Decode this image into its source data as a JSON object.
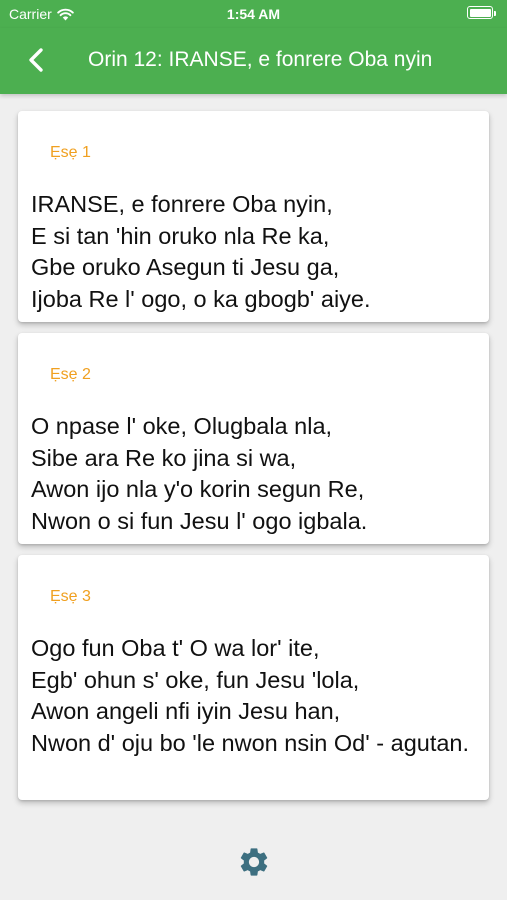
{
  "status_bar": {
    "carrier": "Carrier",
    "time": "1:54 AM",
    "icons": [
      "wifi-icon",
      "battery-icon"
    ]
  },
  "nav": {
    "back_icon": "chevron-left-icon",
    "title": "Orin 12: IRANSE, e fonrere Oba nyin"
  },
  "verses": [
    {
      "label": "Ẹsẹ 1",
      "text": "IRANSE, e fonrere Oba nyin,\nE si tan 'hin oruko nla Re ka,\nGbe oruko Asegun ti Jesu ga,\nIjoba Re l' ogo, o ka gbogb' aiye."
    },
    {
      "label": "Ẹsẹ 2",
      "text": "O npase l' oke, Olugbala nla,\nSibe ara Re ko jina si wa,\nAwon ijo nla y'o korin segun Re,\nNwon o si fun Jesu l' ogo igbala."
    },
    {
      "label": "Ẹsẹ 3",
      "text": "Ogo fun Oba t' O wa lor' ite,\nEgb' ohun s' oke, fun Jesu 'lola,\nAwon  angeli nfi iyin Jesu han,\nNwon d' oju bo 'le nwon nsin Od' - agutan."
    }
  ],
  "bottom_bar": {
    "settings_icon": "gear-icon"
  },
  "colors": {
    "primary": "#4caf50",
    "verse_label": "#f0a020",
    "background": "#efefef"
  }
}
